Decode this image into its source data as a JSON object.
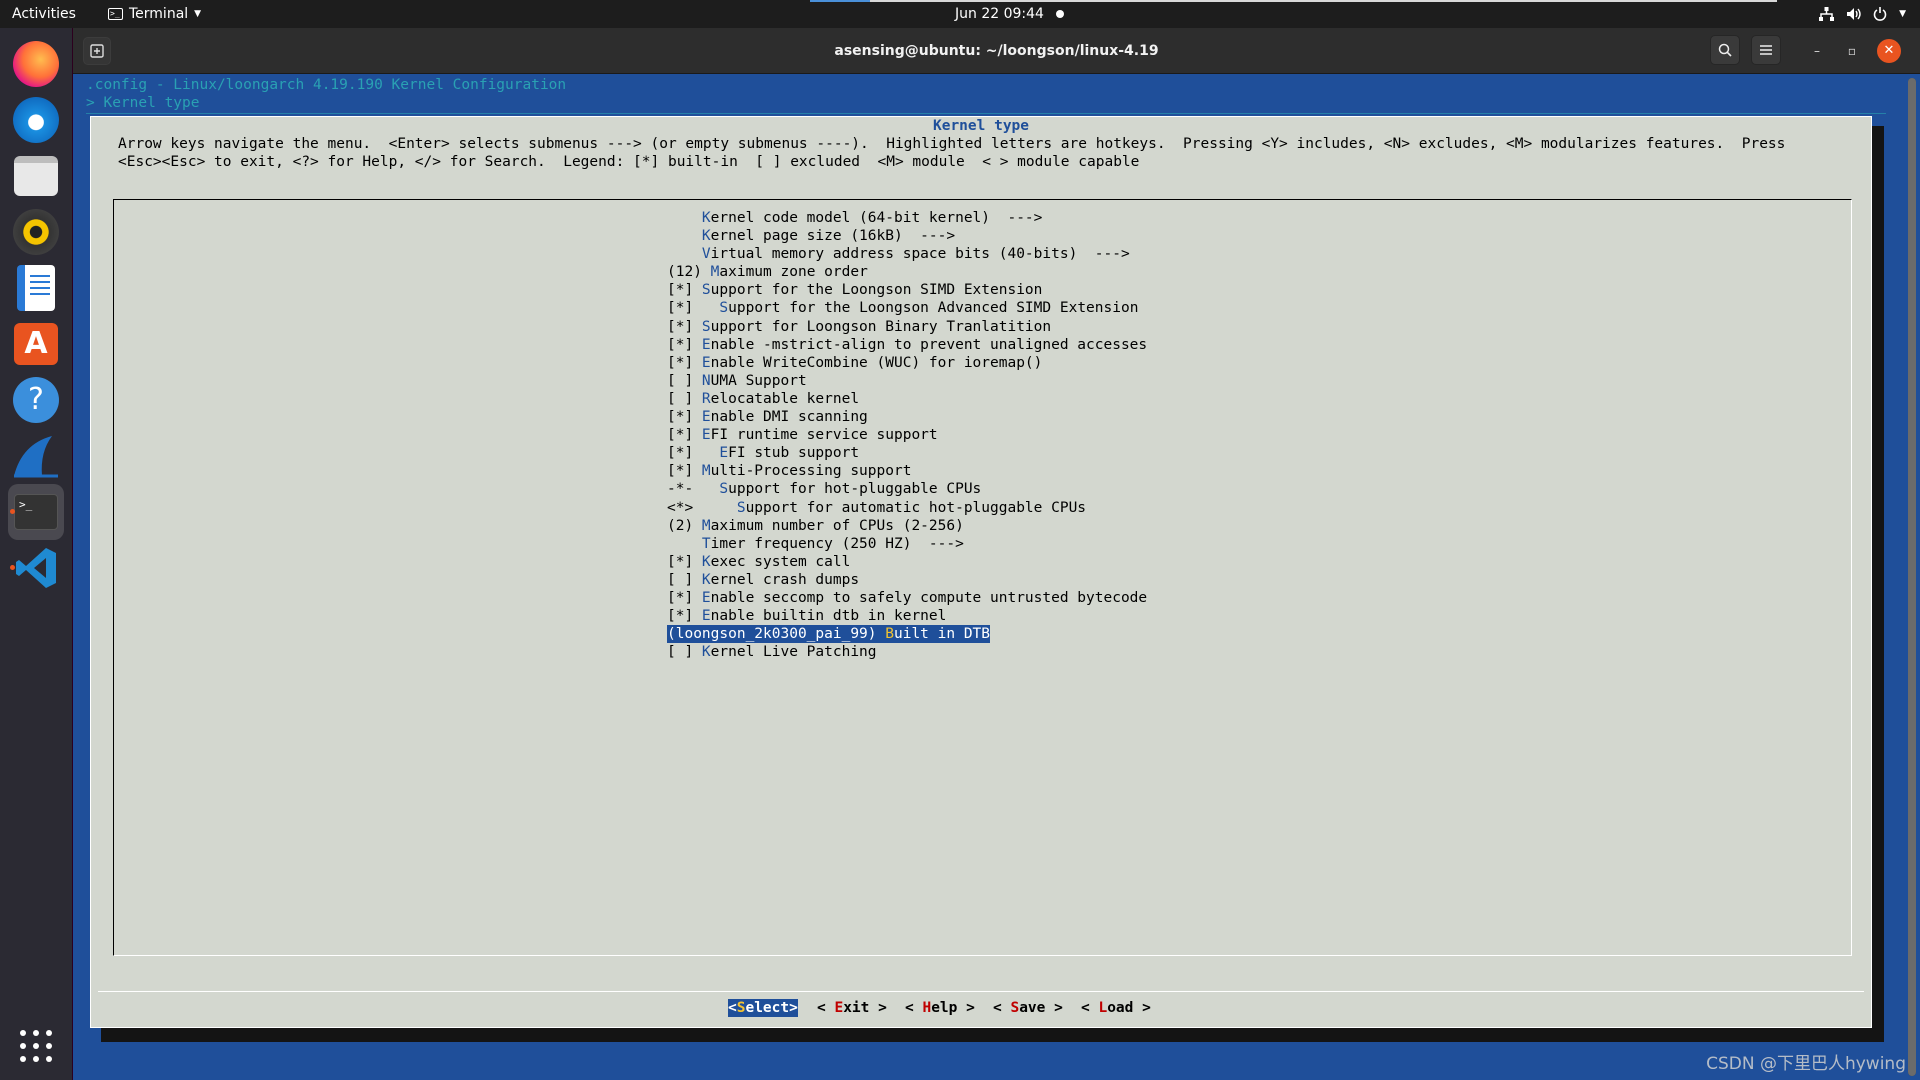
{
  "topbar": {
    "activities": "Activities",
    "app_name": "Terminal",
    "clock": "Jun 22  09:44"
  },
  "dock": {
    "items": [
      {
        "name": "Firefox",
        "icon": "firefox-icon"
      },
      {
        "name": "Thunderbird",
        "icon": "thunderbird-icon"
      },
      {
        "name": "Files",
        "icon": "files-icon"
      },
      {
        "name": "Rhythmbox",
        "icon": "rhythmbox-icon"
      },
      {
        "name": "LibreOffice Writer",
        "icon": "writer-icon"
      },
      {
        "name": "Ubuntu Software",
        "icon": "software-icon"
      },
      {
        "name": "Help",
        "icon": "help-icon"
      },
      {
        "name": "Wireshark",
        "icon": "wireshark-icon"
      },
      {
        "name": "Terminal",
        "icon": "terminal-icon"
      },
      {
        "name": "Visual Studio Code",
        "icon": "vscode-icon"
      }
    ]
  },
  "window": {
    "title": "asensing@ubuntu: ~/loongson/linux-4.19"
  },
  "terminal": {
    "config_title": ".config - Linux/loongarch 4.19.190 Kernel Configuration",
    "breadcrumb": "> Kernel type",
    "dialog": {
      "title": "Kernel type",
      "help_line1": "Arrow keys navigate the menu.  <Enter> selects submenus ---> (or empty submenus ----).  Highlighted letters are hotkeys.  Pressing <Y> includes, <N> excludes, <M> modularizes features.  Press",
      "help_line2": "<Esc><Esc> to exit, <?> for Help, </> for Search.  Legend: [*] built-in  [ ] excluded  <M> module  < > module capable",
      "menu_items": [
        {
          "prefix": "    ",
          "hotkey": "K",
          "rest": "ernel code model (64-bit kernel)  --->"
        },
        {
          "prefix": "    ",
          "hotkey": "K",
          "rest": "ernel page size (16kB)  --->"
        },
        {
          "prefix": "    ",
          "hotkey": "V",
          "rest": "irtual memory address space bits (40-bits)  --->"
        },
        {
          "prefix": "(12) ",
          "hotkey": "M",
          "rest": "aximum zone order"
        },
        {
          "prefix": "[*] ",
          "hotkey": "S",
          "rest": "upport for the Loongson SIMD Extension"
        },
        {
          "prefix": "[*]   ",
          "hotkey": "S",
          "rest": "upport for the Loongson Advanced SIMD Extension"
        },
        {
          "prefix": "[*] ",
          "hotkey": "S",
          "rest": "upport for Loongson Binary Tranlatition"
        },
        {
          "prefix": "[*] ",
          "hotkey": "E",
          "rest": "nable -mstrict-align to prevent unaligned accesses"
        },
        {
          "prefix": "[*] ",
          "hotkey": "E",
          "rest": "nable WriteCombine (WUC) for ioremap()"
        },
        {
          "prefix": "[ ] ",
          "hotkey": "N",
          "rest": "UMA Support"
        },
        {
          "prefix": "[ ] ",
          "hotkey": "R",
          "rest": "elocatable kernel"
        },
        {
          "prefix": "[*] ",
          "hotkey": "E",
          "rest": "nable DMI scanning"
        },
        {
          "prefix": "[*] ",
          "hotkey": "E",
          "rest": "FI runtime service support"
        },
        {
          "prefix": "[*]   ",
          "hotkey": "E",
          "rest": "FI stub support"
        },
        {
          "prefix": "[*] ",
          "hotkey": "M",
          "rest": "ulti-Processing support"
        },
        {
          "prefix": "-*-   ",
          "hotkey": "S",
          "rest": "upport for hot-pluggable CPUs"
        },
        {
          "prefix": "<*>     ",
          "hotkey": "S",
          "rest": "upport for automatic hot-pluggable CPUs"
        },
        {
          "prefix": "(2) ",
          "hotkey": "M",
          "rest": "aximum number of CPUs (2-256)"
        },
        {
          "prefix": "    ",
          "hotkey": "T",
          "rest": "imer frequency (250 HZ)  --->"
        },
        {
          "prefix": "[*] ",
          "hotkey": "K",
          "rest": "exec system call"
        },
        {
          "prefix": "[ ] ",
          "hotkey": "K",
          "rest": "ernel crash dumps"
        },
        {
          "prefix": "[*] ",
          "hotkey": "E",
          "rest": "nable seccomp to safely compute untrusted bytecode"
        },
        {
          "prefix": "[*] ",
          "hotkey": "E",
          "rest": "nable builtin dtb in kernel"
        },
        {
          "prefix": "(loongson_2k0300_pai_99) ",
          "hotkey": "B",
          "rest": "uilt in DTB",
          "selected": true
        },
        {
          "prefix": "[ ] ",
          "hotkey": "K",
          "rest": "ernel Live Patching"
        }
      ],
      "buttons": {
        "select": {
          "pre": "<",
          "hk": "S",
          "post": "elect>"
        },
        "exit": {
          "pre": "< ",
          "hk": "E",
          "post": "xit >"
        },
        "help": {
          "pre": "< ",
          "hk": "H",
          "post": "elp >"
        },
        "save": {
          "pre": "< ",
          "hk": "S",
          "post": "ave >"
        },
        "load": {
          "pre": "< ",
          "hk": "L",
          "post": "oad >"
        }
      }
    }
  },
  "watermark": "CSDN @下里巴人hywing",
  "colors": {
    "terminal_bg": "#1f4f9a",
    "dialog_bg": "#d3d7cf",
    "hotkey_menu": "#1f4f9a",
    "hotkey_button": "#c00000",
    "ubuntu_orange": "#e95420"
  }
}
